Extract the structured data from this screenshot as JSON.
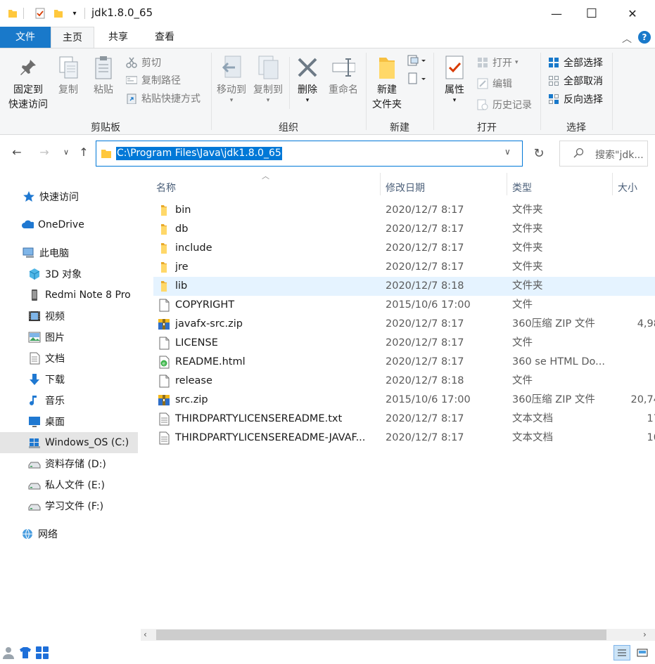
{
  "window": {
    "title": "jdk1.8.0_65",
    "controls": {
      "minimize": "—",
      "maximize": "☐",
      "close": "✕"
    }
  },
  "tabs": [
    {
      "label": "文件",
      "name": "tab-file"
    },
    {
      "label": "主页",
      "name": "tab-home"
    },
    {
      "label": "共享",
      "name": "tab-share"
    },
    {
      "label": "查看",
      "name": "tab-view"
    }
  ],
  "ribbon": {
    "clipboard": {
      "group_label": "剪贴板",
      "pin_line1": "固定到",
      "pin_line2": "快速访问",
      "copy": "复制",
      "paste": "粘贴",
      "cut": "剪切",
      "copy_path": "复制路径",
      "paste_shortcut": "粘贴快捷方式"
    },
    "organize": {
      "group_label": "组织",
      "move_to": "移动到",
      "copy_to": "复制到",
      "delete": "删除",
      "rename": "重命名"
    },
    "new": {
      "group_label": "新建",
      "new_folder_line1": "新建",
      "new_folder_line2": "文件夹"
    },
    "open": {
      "group_label": "打开",
      "properties": "属性",
      "open": "打开",
      "edit": "编辑",
      "history": "历史记录"
    },
    "select": {
      "group_label": "选择",
      "select_all": "全部选择",
      "select_none": "全部取消",
      "invert": "反向选择"
    }
  },
  "address": {
    "path": "C:\\Program Files\\Java\\jdk1.8.0_65",
    "search_placeholder": "搜索\"jdk..."
  },
  "sidebar": {
    "items": [
      {
        "label": "快速访问",
        "icon": "star-icon"
      },
      {
        "label": "OneDrive",
        "icon": "cloud-icon"
      },
      {
        "label": "此电脑",
        "icon": "computer-icon"
      },
      {
        "label": "3D 对象",
        "icon": "cube-icon"
      },
      {
        "label": "Redmi Note 8 Pro",
        "icon": "phone-icon"
      },
      {
        "label": "视频",
        "icon": "video-icon"
      },
      {
        "label": "图片",
        "icon": "picture-icon"
      },
      {
        "label": "文档",
        "icon": "document-icon"
      },
      {
        "label": "下载",
        "icon": "download-icon"
      },
      {
        "label": "音乐",
        "icon": "music-icon"
      },
      {
        "label": "桌面",
        "icon": "desktop-icon"
      },
      {
        "label": "Windows_OS (C:)",
        "icon": "drive-c-icon"
      },
      {
        "label": "资料存储 (D:)",
        "icon": "drive-icon"
      },
      {
        "label": "私人文件 (E:)",
        "icon": "drive-icon"
      },
      {
        "label": "学习文件 (F:)",
        "icon": "drive-icon"
      },
      {
        "label": "网络",
        "icon": "network-icon"
      }
    ]
  },
  "columns": {
    "name": "名称",
    "date": "修改日期",
    "type": "类型",
    "size": "大小"
  },
  "files": [
    {
      "name": "bin",
      "date": "2020/12/7 8:17",
      "type": "文件夹",
      "size": "",
      "icon": "folder-icon"
    },
    {
      "name": "db",
      "date": "2020/12/7 8:17",
      "type": "文件夹",
      "size": "",
      "icon": "folder-icon"
    },
    {
      "name": "include",
      "date": "2020/12/7 8:17",
      "type": "文件夹",
      "size": "",
      "icon": "folder-icon"
    },
    {
      "name": "jre",
      "date": "2020/12/7 8:17",
      "type": "文件夹",
      "size": "",
      "icon": "folder-icon"
    },
    {
      "name": "lib",
      "date": "2020/12/7 8:18",
      "type": "文件夹",
      "size": "",
      "icon": "folder-icon"
    },
    {
      "name": "COPYRIGHT",
      "date": "2015/10/6 17:00",
      "type": "文件",
      "size": "",
      "icon": "file-icon"
    },
    {
      "name": "javafx-src.zip",
      "date": "2020/12/7 8:17",
      "type": "360压缩 ZIP 文件",
      "size": "4,98",
      "icon": "zip-icon"
    },
    {
      "name": "LICENSE",
      "date": "2020/12/7 8:17",
      "type": "文件",
      "size": "",
      "icon": "file-icon"
    },
    {
      "name": "README.html",
      "date": "2020/12/7 8:17",
      "type": "360 se HTML Do...",
      "size": "",
      "icon": "html-icon"
    },
    {
      "name": "release",
      "date": "2020/12/7 8:18",
      "type": "文件",
      "size": "",
      "icon": "file-icon"
    },
    {
      "name": "src.zip",
      "date": "2015/10/6 17:00",
      "type": "360压缩 ZIP 文件",
      "size": "20,74",
      "icon": "zip-icon"
    },
    {
      "name": "THIRDPARTYLICENSEREADME.txt",
      "date": "2020/12/7 8:17",
      "type": "文本文档",
      "size": "17",
      "icon": "text-icon"
    },
    {
      "name": "THIRDPARTYLICENSEREADME-JAVAF...",
      "date": "2020/12/7 8:17",
      "type": "文本文档",
      "size": "10",
      "icon": "text-icon"
    }
  ],
  "hovered_row": 4,
  "colors": {
    "accent": "#0078d7",
    "file_tab": "#1979ca",
    "hover": "#e5f3ff",
    "folder": "#ffc83d"
  }
}
